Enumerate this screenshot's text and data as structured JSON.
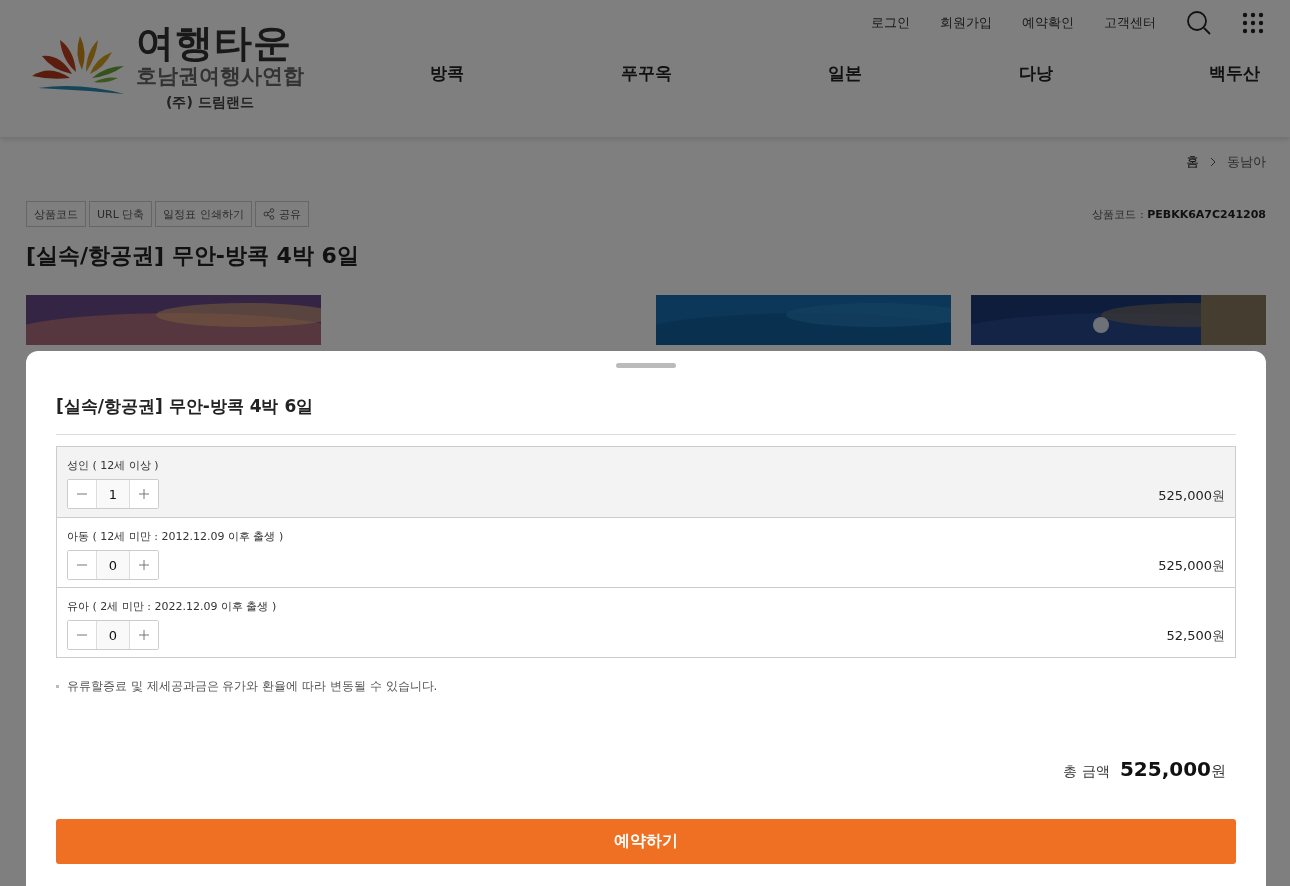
{
  "logo": {
    "name": "여행타운",
    "subtitle": "호남권여행사연합",
    "company": "(주) 드림랜드"
  },
  "top_links": [
    "로그인",
    "회원가입",
    "예약확인",
    "고객센터"
  ],
  "nav": [
    "방콕",
    "푸꾸옥",
    "일본",
    "다낭",
    "백두산"
  ],
  "breadcrumb": [
    "홈",
    "동남아"
  ],
  "tools": [
    {
      "label": "상품코드",
      "kind": "plain"
    },
    {
      "label": "URL 단축",
      "kind": "plain"
    },
    {
      "label": "일정표 인쇄하기",
      "kind": "plain"
    },
    {
      "label": "공유",
      "kind": "share"
    }
  ],
  "product_code": {
    "label": "상품코드 : ",
    "value": "PEBKK6A7C241208"
  },
  "title": "[실속/항공권] 무안-방콕 4박 6일",
  "gallery": [
    {
      "kind": "picture"
    },
    {
      "kind": "picture"
    },
    {
      "kind": "picture"
    }
  ],
  "sheet": {
    "title": "[실속/항공권] 무안-방콕 4박 6일",
    "options": [
      {
        "label": "성인 ( 12세 이상 )",
        "count": "1",
        "price": "525,000",
        "unit": "원",
        "selected": true
      },
      {
        "label": "아동 ( 12세 미만 : 2012.12.09 이후 출생 )",
        "count": "0",
        "price": "525,000",
        "unit": "원",
        "selected": false
      },
      {
        "label": "유아 ( 2세 미만 : 2022.12.09 이후 출생 )",
        "count": "0",
        "price": "52,500",
        "unit": "원",
        "selected": false
      }
    ],
    "note": "유류할증료 및 제세공과금은 유가와 환율에 따라 변동될 수 있습니다.",
    "total": {
      "label": "총 금액",
      "value": "525,000",
      "unit": "원"
    },
    "button": "예약하기"
  }
}
